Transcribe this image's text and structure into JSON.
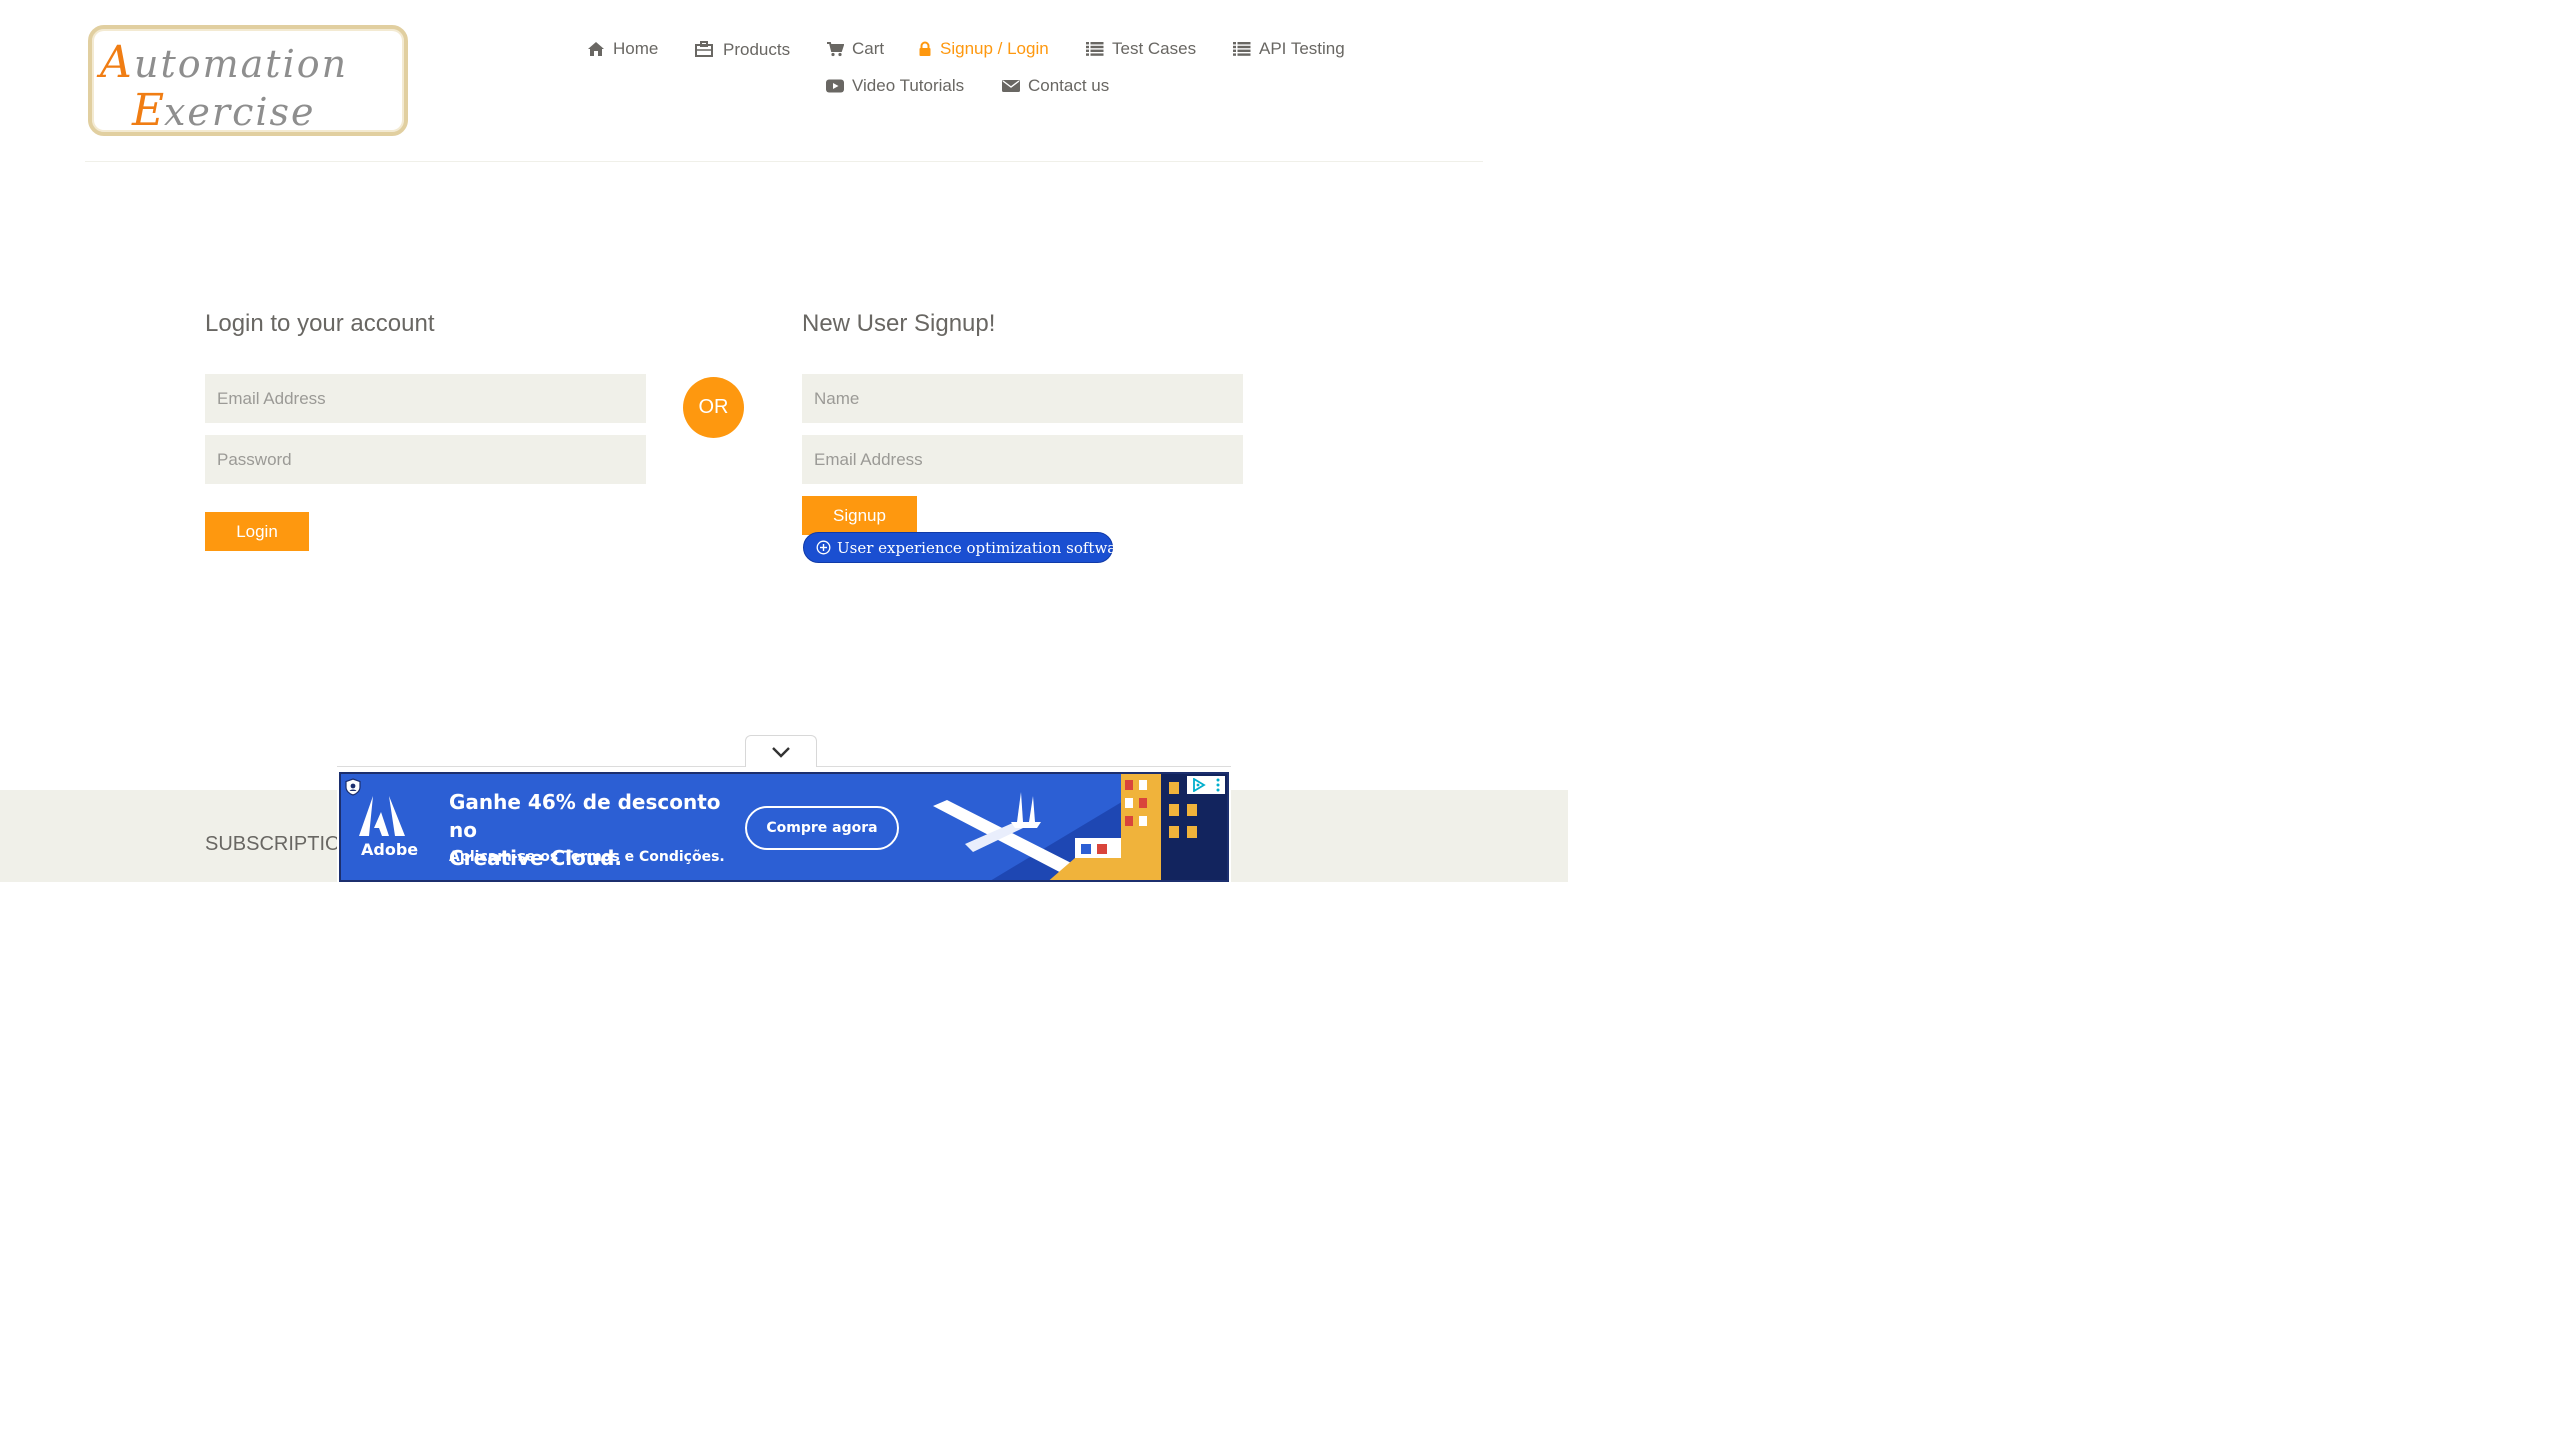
{
  "header": {
    "logo": {
      "line1": "Automation",
      "line2": "Exercise"
    },
    "nav": [
      {
        "label": "Home",
        "icon": "home-icon"
      },
      {
        "label": "Products",
        "icon": "briefcase-icon"
      },
      {
        "label": "Cart",
        "icon": "cart-icon"
      },
      {
        "label": "Signup / Login",
        "icon": "lock-icon",
        "active": true
      },
      {
        "label": "Test Cases",
        "icon": "list-icon"
      },
      {
        "label": "API Testing",
        "icon": "list-icon"
      },
      {
        "label": "Video Tutorials",
        "icon": "youtube-play-icon"
      },
      {
        "label": "Contact us",
        "icon": "envelope-icon"
      }
    ]
  },
  "login": {
    "title": "Login to your account",
    "email_placeholder": "Email Address",
    "password_placeholder": "Password",
    "button_label": "Login"
  },
  "divider": {
    "or_label": "OR"
  },
  "signup": {
    "title": "New User Signup!",
    "name_placeholder": "Name",
    "email_placeholder": "Email Address",
    "button_label": "Signup"
  },
  "ux_badge": {
    "label": "User experience optimization software"
  },
  "footer": {
    "subscription_title": "SUBSCRIPTIO"
  },
  "ad": {
    "brand": "Adobe",
    "headline_line1": "Ganhe 46% de desconto no",
    "headline_line2": "Creative Cloud.",
    "terms": "Aplicam-se os Termos e Condições.",
    "cta_label": "Compre agora"
  },
  "colors": {
    "accent": "#fe980f",
    "text": "#696763",
    "input_bg": "#f0f0e9",
    "ad_blue": "#2c5fd4",
    "badge_blue": "#1a4fd1"
  }
}
